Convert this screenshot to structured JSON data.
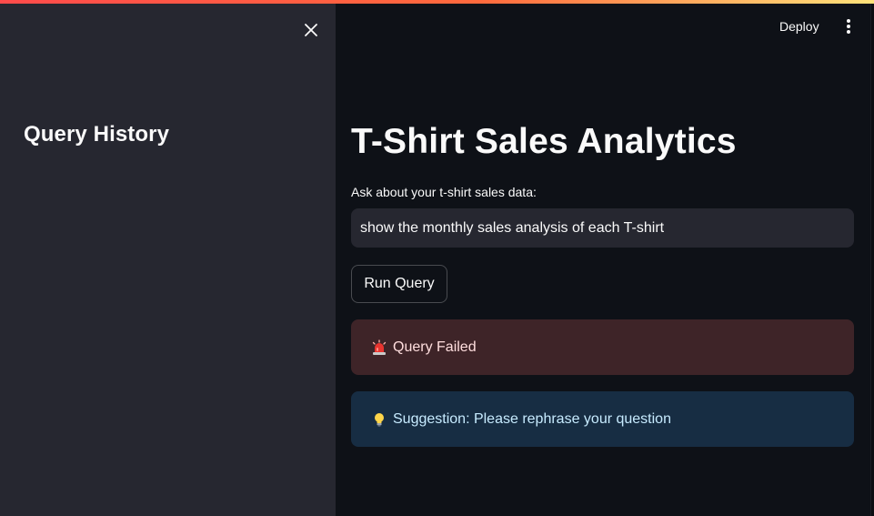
{
  "header": {
    "deploy_label": "Deploy",
    "menu_icon": "vertical-dots-icon",
    "accent_gradient": [
      "#ff4b4b",
      "#ffe27a"
    ]
  },
  "sidebar": {
    "title": "Query History",
    "close_icon": "close-icon",
    "background": "#262730"
  },
  "main": {
    "title": "T-Shirt Sales Analytics",
    "input_label": "Ask about your t-shirt sales data:",
    "input_value": "show the monthly sales analysis of each T-shirt",
    "run_button_label": "Run Query",
    "error": {
      "icon": "rotating-light-icon",
      "text": "Query Failed",
      "color": "#3e2428"
    },
    "info": {
      "icon": "light-bulb-icon",
      "text": "Suggestion: Please rephrase your question",
      "color": "#172d43"
    }
  }
}
